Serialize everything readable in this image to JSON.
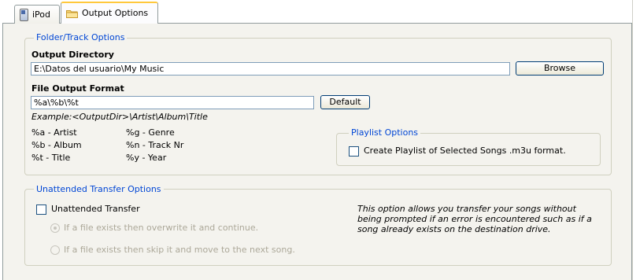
{
  "tabs": [
    {
      "label": "iPod",
      "icon": "ipod-icon"
    },
    {
      "label": "Output Options",
      "icon": "folder-icon"
    }
  ],
  "folder_track": {
    "legend": "Folder/Track Options",
    "output_directory_label": "Output Directory",
    "output_directory_value": "E:\\Datos del usuario\\My Music",
    "browse_label": "Browse",
    "file_format_label": "File Output Format",
    "file_format_value": "%a\\%b\\%t",
    "default_label": "Default",
    "example": "Example:<OutputDir>\\Artist\\Album\\Title",
    "codes_left": [
      "%a - Artist",
      "%b - Album",
      "%t  - Title"
    ],
    "codes_right": [
      "%g - Genre",
      "%n - Track Nr",
      "%y - Year"
    ]
  },
  "playlist": {
    "legend": "Playlist Options",
    "checkbox_label": "Create Playlist of Selected Songs .m3u format.",
    "checked": false
  },
  "unattended": {
    "legend": "Unattended Transfer Options",
    "checkbox_label": "Unattended Transfer",
    "checked": false,
    "radio_overwrite": "If a file exists then overwrite it and continue.",
    "radio_skip": "If a file exists then skip it and move to the next song.",
    "description_lines": [
      "This option allows you transfer your songs without",
      "being prompted if an error is encountered such as if a",
      "song already exists on the destination drive."
    ]
  }
}
